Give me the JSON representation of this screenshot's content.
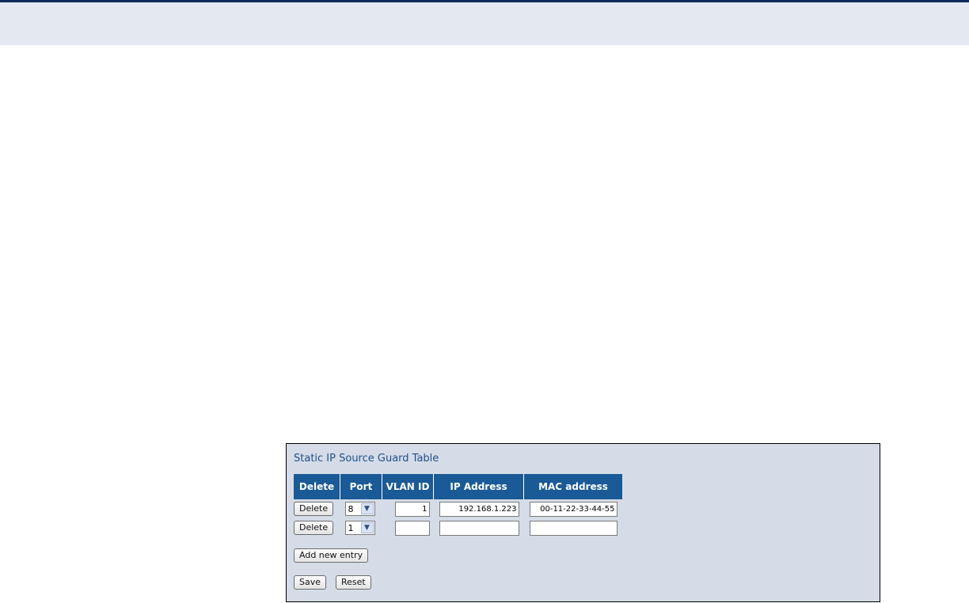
{
  "page": {
    "colors": {
      "top_rule": "#0f2a5e",
      "header_band": "#e4e8f0",
      "panel_bg": "#d5dce8",
      "title": "#1f4f8d",
      "table_header_bg": "#1a5a96"
    }
  },
  "panel": {
    "title": "Static IP Source Guard Table",
    "columns": [
      "Delete",
      "Port",
      "VLAN ID",
      "IP Address",
      "MAC address"
    ],
    "rows": [
      {
        "delete_label": "Delete",
        "port": "8",
        "vlan_id": "1",
        "ip_address": "192.168.1.223",
        "mac_address": "00-11-22-33-44-55"
      },
      {
        "delete_label": "Delete",
        "port": "1",
        "vlan_id": "",
        "ip_address": "",
        "mac_address": ""
      }
    ],
    "add_entry_label": "Add new entry",
    "save_label": "Save",
    "reset_label": "Reset",
    "dropdown_icon": "chevron-down-icon"
  }
}
